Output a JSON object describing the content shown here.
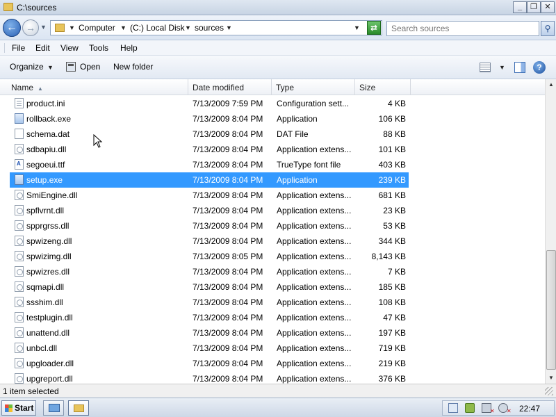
{
  "window": {
    "title": "C:\\sources",
    "minimize_label": "_",
    "maximize_label": "❐",
    "close_label": "✕"
  },
  "address": {
    "back_label": "←",
    "forward_label": "→",
    "crumbs": [
      "Computer",
      "(C:) Local Disk",
      "sources"
    ],
    "search_placeholder": "Search sources"
  },
  "menu": {
    "items": [
      "File",
      "Edit",
      "View",
      "Tools",
      "Help"
    ]
  },
  "toolbar": {
    "organize_label": "Organize",
    "open_label": "Open",
    "new_folder_label": "New folder",
    "help_label": "?"
  },
  "columns": {
    "name": "Name",
    "date": "Date modified",
    "type": "Type",
    "size": "Size"
  },
  "files": [
    {
      "name": "product.ini",
      "date": "7/13/2009 7:59 PM",
      "type": "Configuration sett...",
      "size": "4 KB",
      "icon": "cfg"
    },
    {
      "name": "rollback.exe",
      "date": "7/13/2009 8:04 PM",
      "type": "Application",
      "size": "106 KB",
      "icon": "exe"
    },
    {
      "name": "schema.dat",
      "date": "7/13/2009 8:04 PM",
      "type": "DAT File",
      "size": "88 KB",
      "icon": "file"
    },
    {
      "name": "sdbapiu.dll",
      "date": "7/13/2009 8:04 PM",
      "type": "Application extens...",
      "size": "101 KB",
      "icon": "dll"
    },
    {
      "name": "segoeui.ttf",
      "date": "7/13/2009 8:04 PM",
      "type": "TrueType font file",
      "size": "403 KB",
      "icon": "font"
    },
    {
      "name": "setup.exe",
      "date": "7/13/2009 8:04 PM",
      "type": "Application",
      "size": "239 KB",
      "icon": "exe",
      "selected": true
    },
    {
      "name": "SmiEngine.dll",
      "date": "7/13/2009 8:04 PM",
      "type": "Application extens...",
      "size": "681 KB",
      "icon": "dll"
    },
    {
      "name": "spflvrnt.dll",
      "date": "7/13/2009 8:04 PM",
      "type": "Application extens...",
      "size": "23 KB",
      "icon": "dll"
    },
    {
      "name": "spprgrss.dll",
      "date": "7/13/2009 8:04 PM",
      "type": "Application extens...",
      "size": "53 KB",
      "icon": "dll"
    },
    {
      "name": "spwizeng.dll",
      "date": "7/13/2009 8:04 PM",
      "type": "Application extens...",
      "size": "344 KB",
      "icon": "dll"
    },
    {
      "name": "spwizimg.dll",
      "date": "7/13/2009 8:05 PM",
      "type": "Application extens...",
      "size": "8,143 KB",
      "icon": "dll"
    },
    {
      "name": "spwizres.dll",
      "date": "7/13/2009 8:04 PM",
      "type": "Application extens...",
      "size": "7 KB",
      "icon": "dll"
    },
    {
      "name": "sqmapi.dll",
      "date": "7/13/2009 8:04 PM",
      "type": "Application extens...",
      "size": "185 KB",
      "icon": "dll"
    },
    {
      "name": "ssshim.dll",
      "date": "7/13/2009 8:04 PM",
      "type": "Application extens...",
      "size": "108 KB",
      "icon": "dll"
    },
    {
      "name": "testplugin.dll",
      "date": "7/13/2009 8:04 PM",
      "type": "Application extens...",
      "size": "47 KB",
      "icon": "dll"
    },
    {
      "name": "unattend.dll",
      "date": "7/13/2009 8:04 PM",
      "type": "Application extens...",
      "size": "197 KB",
      "icon": "dll"
    },
    {
      "name": "unbcl.dll",
      "date": "7/13/2009 8:04 PM",
      "type": "Application extens...",
      "size": "719 KB",
      "icon": "dll"
    },
    {
      "name": "upgloader.dll",
      "date": "7/13/2009 8:04 PM",
      "type": "Application extens...",
      "size": "219 KB",
      "icon": "dll"
    },
    {
      "name": "upgreport.dll",
      "date": "7/13/2009 8:04 PM",
      "type": "Application extens...",
      "size": "376 KB",
      "icon": "dll"
    }
  ],
  "status": {
    "text": "1 item selected"
  },
  "taskbar": {
    "start_label": "Start",
    "clock": "22:47"
  },
  "colors": {
    "selection": "#3399ff",
    "accent": "#2b61b4"
  }
}
